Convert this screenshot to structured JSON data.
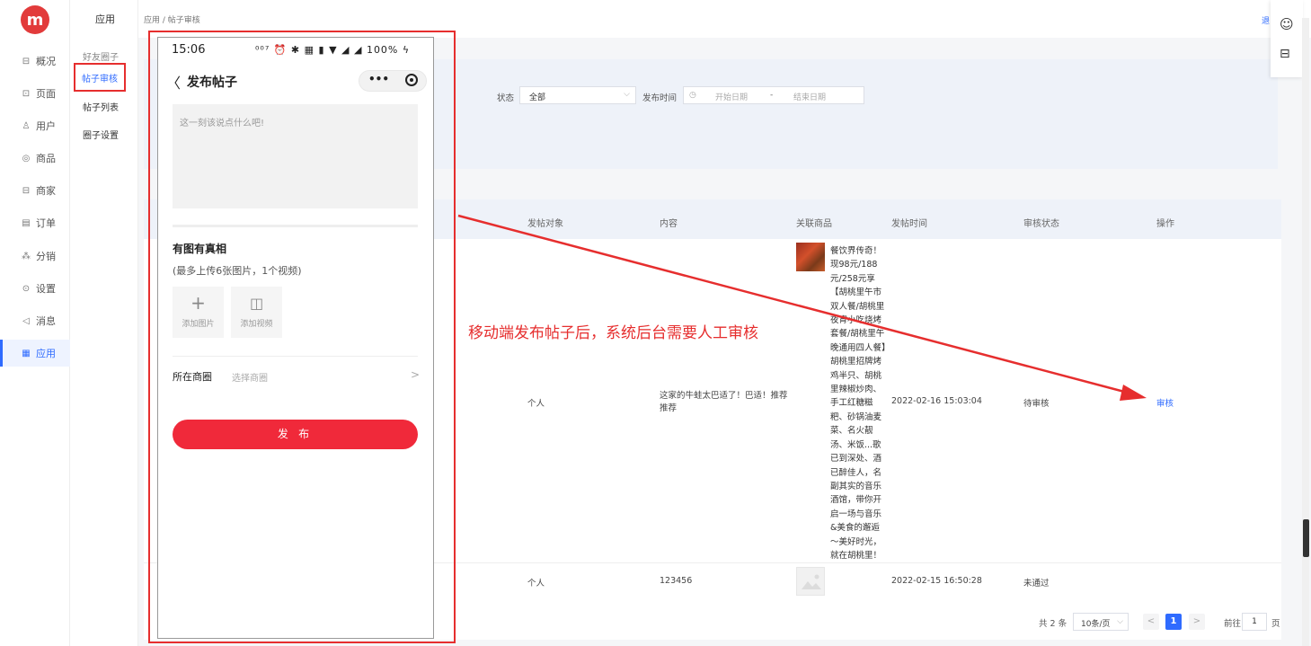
{
  "nav": {
    "items": [
      {
        "icon": "chart-icon",
        "glyph": "⊟",
        "label": "概况"
      },
      {
        "icon": "page-icon",
        "glyph": "⊡",
        "label": "页面"
      },
      {
        "icon": "user-icon",
        "glyph": "♙",
        "label": "用户"
      },
      {
        "icon": "goods-icon",
        "glyph": "◎",
        "label": "商品"
      },
      {
        "icon": "store-icon",
        "glyph": "⊟",
        "label": "商家"
      },
      {
        "icon": "order-icon",
        "glyph": "▤",
        "label": "订单"
      },
      {
        "icon": "share-icon",
        "glyph": "⁂",
        "label": "分销"
      },
      {
        "icon": "settings-icon",
        "glyph": "⊙",
        "label": "设置"
      },
      {
        "icon": "message-icon",
        "glyph": "◁",
        "label": "消息"
      },
      {
        "icon": "apps-icon",
        "glyph": "▦",
        "label": "应用"
      }
    ],
    "logo": "m"
  },
  "subnav": {
    "title": "应用",
    "group": "好友圈子",
    "active": "帖子审核",
    "items": [
      "帖子列表",
      "圈子设置"
    ]
  },
  "breadcrumb": "应用 / 帖子审核",
  "top_right_link": "退",
  "filters": {
    "status_label": "状态",
    "status_value": "全部",
    "time_label": "发布时间",
    "start_placeholder": "开始日期",
    "dash": "-",
    "end_placeholder": "结束日期"
  },
  "table": {
    "headers": [
      "发帖对象",
      "内容",
      "关联商品",
      "发帖时间",
      "审核状态",
      "操作"
    ],
    "rows": [
      {
        "target": "个人",
        "content": "这家的牛蛙太巴适了！巴适！推荐推荐",
        "product": "餐饮界传奇！现98元/188元/258元享【胡桃里午市双人餐/胡桃里夜宵小吃烧烤套餐/胡桃里午晚通用四人餐】胡桃里招牌烤鸡半只、胡桃里辣椒炒肉、手工红糖糍粑、砂锅油麦菜、名火靓汤、米饭...歌已到深处、酒已醉佳人，名副其实的音乐酒馆，带你开启一场与音乐&美食的邂逅～美好时光，就在胡桃里！",
        "time": "2022-02-16 15:03:04",
        "status": "待审核",
        "action": "审核"
      },
      {
        "target": "个人",
        "content": "123456",
        "time": "2022-02-15 16:50:28",
        "status": "未通过"
      }
    ]
  },
  "pager": {
    "total": "共 2 条",
    "page_size": "10条/页",
    "prev": "<",
    "page": "1",
    "next": ">",
    "goto": "前往",
    "goto_value": "1",
    "page_word": "页"
  },
  "phone": {
    "time": "15:06",
    "status_icons": "⁰⁰⁷ ⏰ ✱ ▦ ▮ ▼ ◢ ◢ 100% ϟ",
    "back": "〈",
    "title": "发布帖子",
    "more": "•••",
    "textarea_placeholder": "这一刻该说点什么吧!",
    "section_title": "有图有真相",
    "upload_hint": "(最多上传6张图片，1个视频)",
    "add_image": "添加图片",
    "add_video": "添加视频",
    "circle_label": "所在商圈",
    "circle_placeholder": "选择商圈",
    "chevron": ">",
    "publish": "发 布"
  },
  "annotation": "移动端发布帖子后，系统后台需要人工审核",
  "colors": {
    "accent": "#2f6bff",
    "annotation_red": "#e62e2e",
    "publish_red": "#f0293a"
  }
}
